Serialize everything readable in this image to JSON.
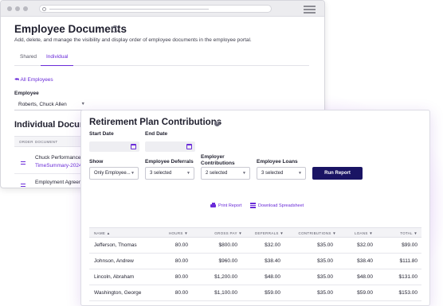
{
  "back_window": {
    "title": "Employee Documents",
    "subtitle": "Add, delete, and manage the visibility and display order of employee documents in the employee portal.",
    "tabs": [
      "Shared",
      "Individual"
    ],
    "back_link": "⮪ All Employees",
    "employee_label": "Employee",
    "employee_value": "Roberts, Chuck Allen",
    "section_title": "Individual Documents",
    "doc_columns": [
      "ORDER",
      "DOCUMENT"
    ],
    "docs": [
      {
        "name": "Chuck Performance Review",
        "file": "TimeSummary-2024..."
      },
      {
        "name": "Employment Agreement"
      }
    ]
  },
  "report": {
    "title": "Retirement Plan Contributions",
    "start_date_label": "Start Date",
    "end_date_label": "End Date",
    "show_label": "Show",
    "show_value": "Only Employee...",
    "deferrals_label": "Employee Deferrals",
    "deferrals_value": "3 selected",
    "contrib_label": "Employer Contributions",
    "contrib_value": "2 selected",
    "loans_label": "Employee Loans",
    "loans_value": "3 selected",
    "run_button": "Run Report",
    "print_label": "Print Report",
    "download_label": "Download Spreadsheet",
    "columns": [
      "NAME ▲",
      "HOURS ▼",
      "GROSS PAY ▼",
      "DEFERRALS ▼",
      "CONTRIBUTIONS ▼",
      "LOANS ▼",
      "TOTAL ▼"
    ],
    "rows": [
      {
        "name": "Jefferson, Thomas",
        "hours": "80.00",
        "gross": "$800.00",
        "deferrals": "$32.00",
        "contributions": "$35.00",
        "loans": "$32.00",
        "total": "$99.00"
      },
      {
        "name": "Johnson, Andrew",
        "hours": "80.00",
        "gross": "$960.00",
        "deferrals": "$38.40",
        "contributions": "$35.00",
        "loans": "$38.40",
        "total": "$111.80"
      },
      {
        "name": "Lincoln, Abraham",
        "hours": "80.00",
        "gross": "$1,200.00",
        "deferrals": "$48.00",
        "contributions": "$35.00",
        "loans": "$48.00",
        "total": "$131.00"
      },
      {
        "name": "Washington, George",
        "hours": "80.00",
        "gross": "$1,100.00",
        "deferrals": "$59.00",
        "contributions": "$35.00",
        "loans": "$59.00",
        "total": "$153.00"
      }
    ]
  },
  "colors": {
    "accent": "#6a2bd8",
    "button": "#1a1464",
    "glow": "#c58cf5"
  },
  "icons": [
    "help-icon",
    "calendar-icon",
    "caret-down-icon",
    "print-icon",
    "spreadsheet-icon",
    "drag-handle-icon",
    "back-arrow-icon"
  ]
}
